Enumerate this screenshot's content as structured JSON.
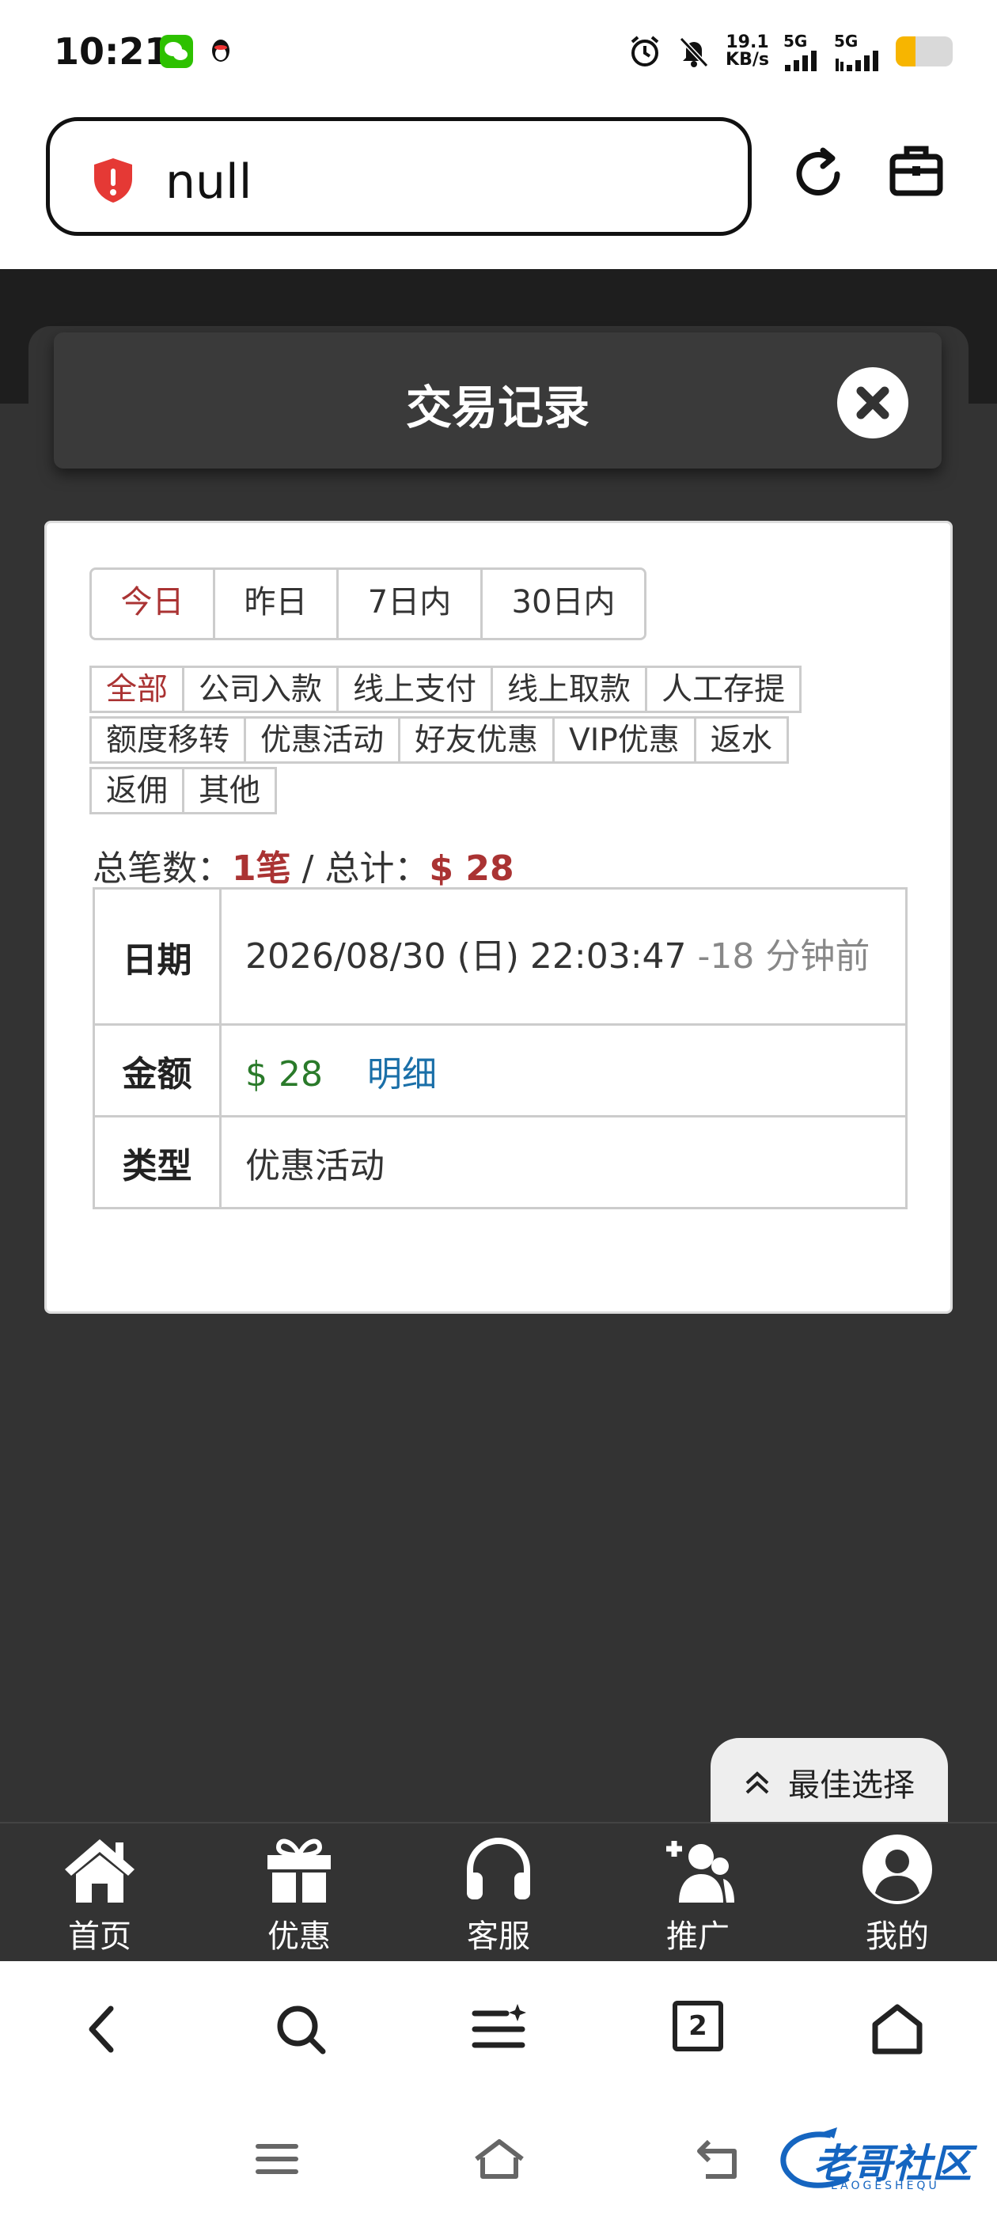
{
  "status_bar": {
    "time": "10:21",
    "net_speed_value": "19.1",
    "net_speed_unit": "KB/s",
    "signal_1": "5G",
    "signal_2": "5G",
    "battery_level": 0.35
  },
  "address_bar": {
    "url": "null"
  },
  "modal": {
    "title": "交易记录"
  },
  "date_tabs": [
    {
      "label": "今日",
      "active": true
    },
    {
      "label": "昨日",
      "active": false
    },
    {
      "label": "7日内",
      "active": false
    },
    {
      "label": "30日内",
      "active": false
    }
  ],
  "type_tags": [
    [
      "全部",
      "公司入款",
      "线上支付",
      "线上取款",
      "人工存提"
    ],
    [
      "额度移转",
      "优惠活动",
      "好友优惠",
      "VIP优惠",
      "返水"
    ],
    [
      "返佣",
      "其他"
    ]
  ],
  "summary": {
    "count_label": "总笔数：",
    "count_value": "1笔",
    "separator": " / ",
    "total_label": "总计：",
    "total_value": "$ 28"
  },
  "record": {
    "date_label": "日期",
    "date_value": "2026/08/30 (日) 22:03:47",
    "date_ago": "-18 分钟前",
    "amount_label": "金额",
    "amount_value": "$ 28",
    "detail_link": "明细",
    "type_label": "类型",
    "type_value": "优惠活动"
  },
  "best_choice": {
    "label": "最佳选择"
  },
  "app_nav": [
    {
      "label": "首页",
      "icon": "home-icon"
    },
    {
      "label": "优惠",
      "icon": "gift-icon"
    },
    {
      "label": "客服",
      "icon": "headset-icon"
    },
    {
      "label": "推广",
      "icon": "add-user-icon"
    },
    {
      "label": "我的",
      "icon": "user-icon"
    }
  ],
  "browser_bar": {
    "tab_count": "2"
  },
  "watermark": {
    "text": "老哥社区",
    "subtext": "LAOGESHEQU"
  }
}
